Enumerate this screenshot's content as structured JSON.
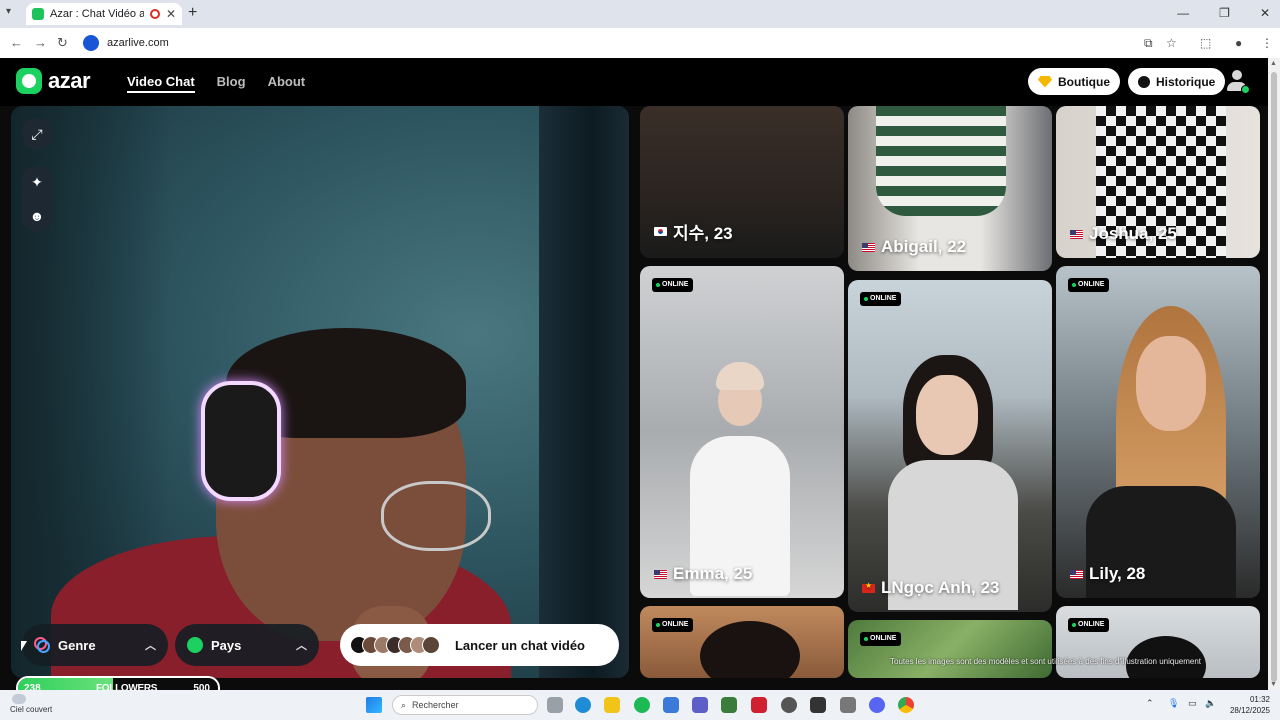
{
  "browser": {
    "tab_title": "Azar : Chat Vidéo avec de",
    "url": "azarlive.com"
  },
  "header": {
    "logo_text": "azar",
    "nav": [
      "Video Chat",
      "Blog",
      "About"
    ],
    "boutique_label": "Boutique",
    "historique_label": "Historique"
  },
  "controls": {
    "genre_label": "Genre",
    "pays_label": "Pays",
    "start_label": "Lancer un chat vidéo"
  },
  "profiles": [
    {
      "name": "지수, 23",
      "flag": "kr",
      "online": ""
    },
    {
      "name": "Abigail, 22",
      "flag": "us",
      "online": ""
    },
    {
      "name": "Joshua, 25",
      "flag": "us",
      "online": ""
    },
    {
      "name": "Emma, 25",
      "flag": "us",
      "online": "ONLINE"
    },
    {
      "name": "LNgọc Anh, 23",
      "flag": "vn",
      "online": "ONLINE"
    },
    {
      "name": "Lily, 28",
      "flag": "us",
      "online": "ONLINE"
    },
    {
      "name": "",
      "flag": "",
      "online": "ONLINE"
    },
    {
      "name": "",
      "flag": "",
      "online": "ONLINE"
    },
    {
      "name": "",
      "flag": "",
      "online": "ONLINE"
    }
  ],
  "disclaimer": "Toutes les images sont des modèles et sont utilisées à des fins d'illustration uniquement",
  "followers": {
    "count": "238",
    "label": "FOLLOWERS",
    "goal": "500",
    "progress_fraction": 0.476
  },
  "taskbar": {
    "weather": "Ciel couvert",
    "search_placeholder": "Rechercher",
    "time": "01:32",
    "date": "28/12/2025"
  },
  "colors": {
    "brand_green": "#1bd15f",
    "online_dot": "#1bd15f"
  }
}
